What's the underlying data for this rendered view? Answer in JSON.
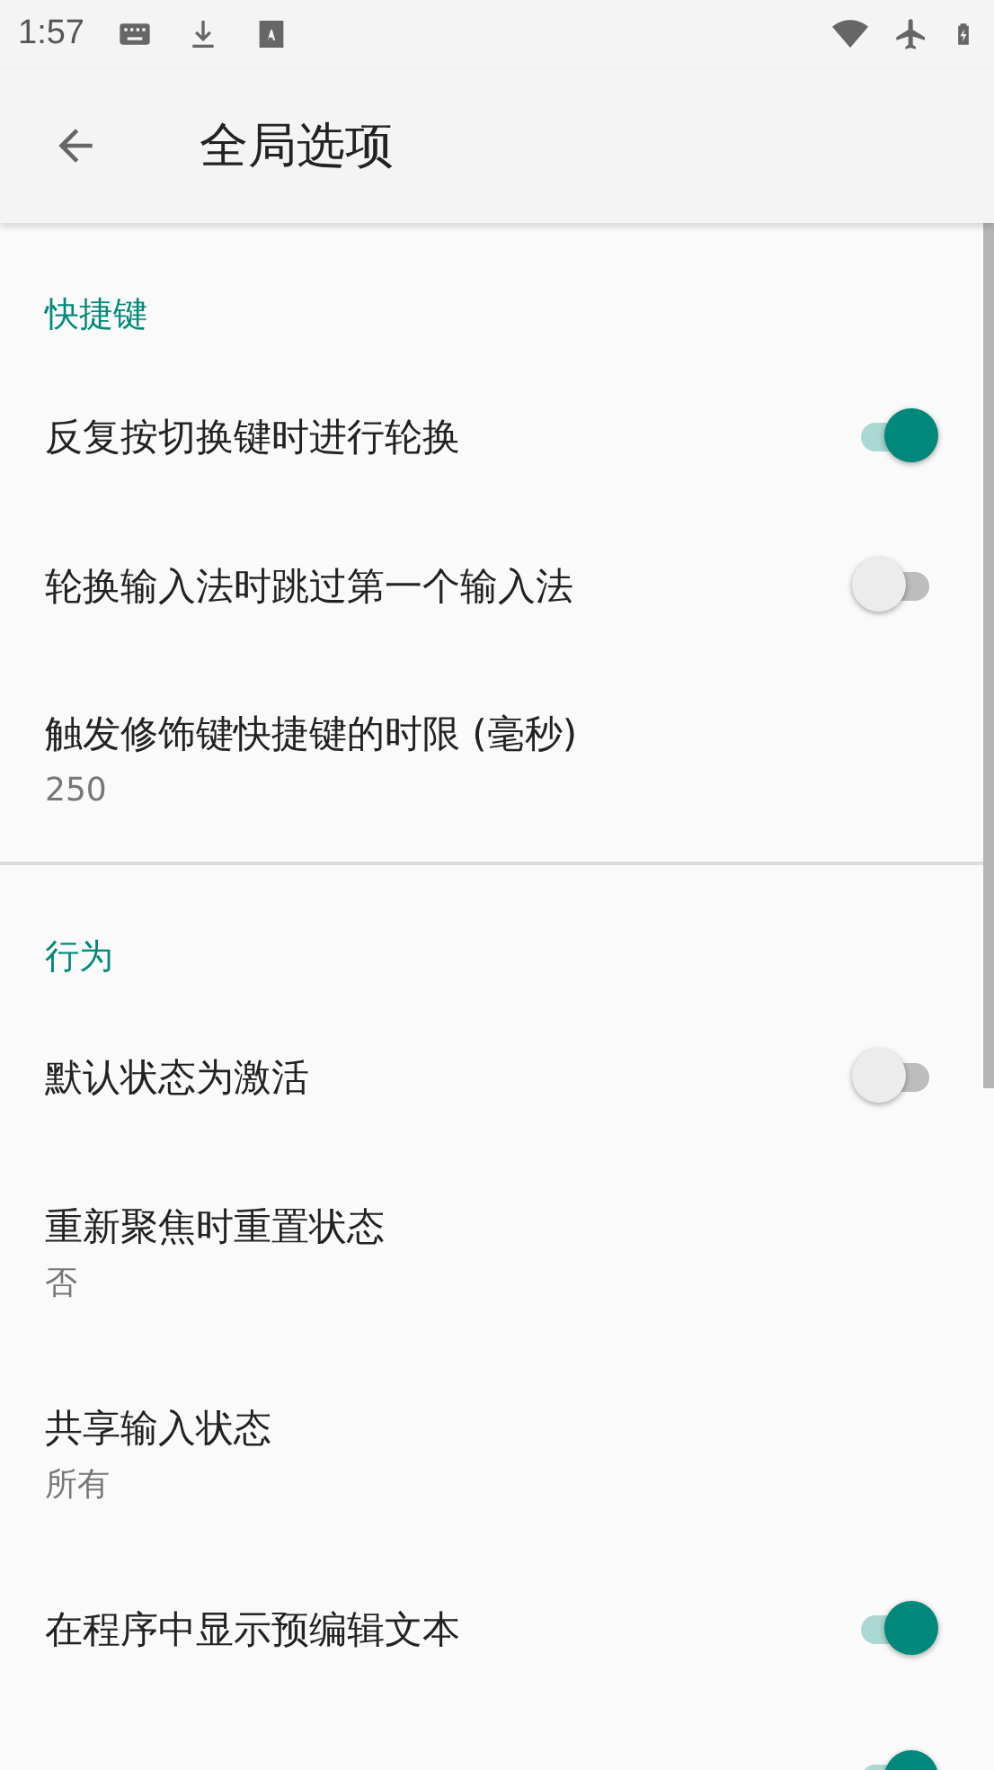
{
  "status_bar": {
    "time": "1:57"
  },
  "app_bar": {
    "title": "全局选项"
  },
  "sections": [
    {
      "title": "快捷键",
      "items": [
        {
          "kind": "switch",
          "title": "反复按切换键时进行轮换",
          "on": true
        },
        {
          "kind": "switch",
          "title": "轮换输入法时跳过第一个输入法",
          "on": false
        },
        {
          "kind": "value",
          "title": "触发修饰键快捷键的时限 (毫秒)",
          "summary": "250"
        }
      ]
    },
    {
      "title": "行为",
      "items": [
        {
          "kind": "switch",
          "title": "默认状态为激活",
          "on": false
        },
        {
          "kind": "value",
          "title": "重新聚焦时重置状态",
          "summary": "否"
        },
        {
          "kind": "value",
          "title": "共享输入状态",
          "summary": "所有"
        },
        {
          "kind": "switch",
          "title": "在程序中显示预编辑文本",
          "on": true
        },
        {
          "kind": "switch",
          "on": true
        }
      ]
    }
  ]
}
